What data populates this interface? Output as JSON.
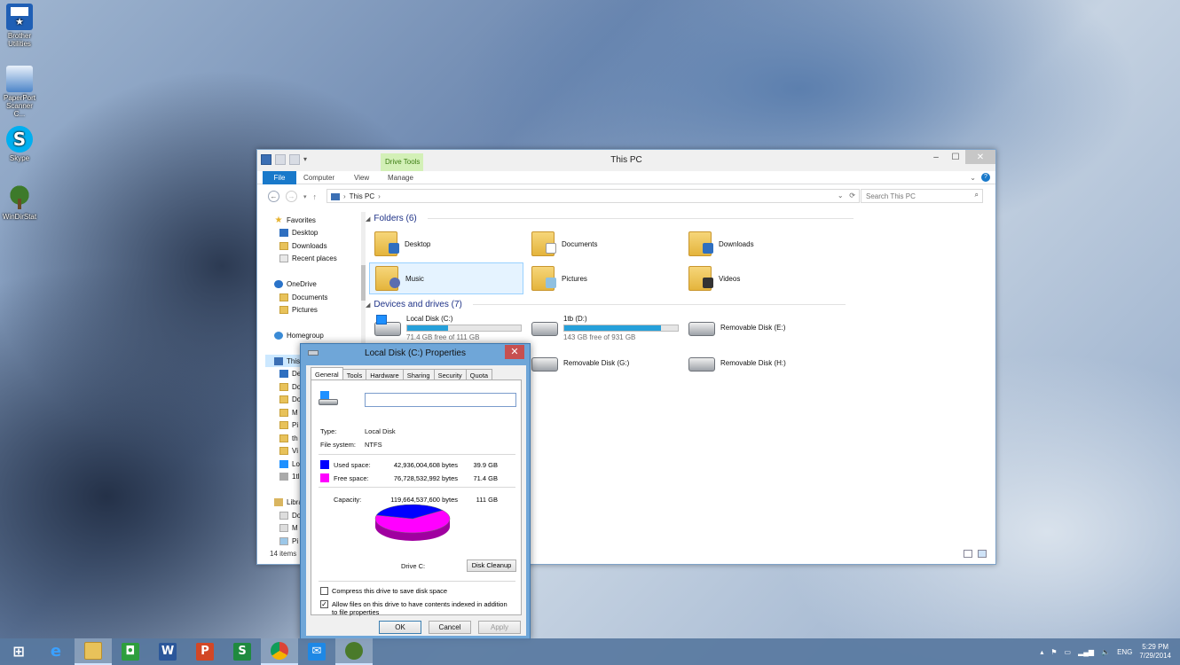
{
  "desktop": {
    "icons": [
      {
        "label": "Brother Utilities"
      },
      {
        "label": "PaperPort Scanner C..."
      },
      {
        "label": "Skype"
      },
      {
        "label": "WinDirStat"
      }
    ]
  },
  "explorer": {
    "title": "This PC",
    "context_tab": "Drive Tools",
    "tabs": [
      "File",
      "Computer",
      "View",
      "Manage"
    ],
    "address": "This PC",
    "search_placeholder": "Search This PC",
    "nav": {
      "favorites": "Favorites",
      "desktop": "Desktop",
      "downloads": "Downloads",
      "recent": "Recent places",
      "onedrive": "OneDrive",
      "documents": "Documents",
      "pictures": "Pictures",
      "homegroup": "Homegroup",
      "thispc": "This PC",
      "thispc_children": [
        "De",
        "Do",
        "Do",
        "M",
        "Pi",
        "th",
        "Vi",
        "Lo",
        "1tl"
      ],
      "libraries": "Libra",
      "lib_children": [
        "Do",
        "M",
        "Pi"
      ]
    },
    "folders_header": "Folders (6)",
    "folders": [
      {
        "name": "Desktop"
      },
      {
        "name": "Documents"
      },
      {
        "name": "Downloads"
      },
      {
        "name": "Music"
      },
      {
        "name": "Pictures"
      },
      {
        "name": "Videos"
      }
    ],
    "devices_header": "Devices and drives (7)",
    "drives": [
      {
        "name": "Local Disk (C:)",
        "free": "71.4 GB free of 111 GB",
        "used_fraction": 0.36
      },
      {
        "name": "1tb (D:)",
        "free": "143 GB free of 931 GB",
        "used_fraction": 0.85
      },
      {
        "name": "Removable Disk (E:)"
      },
      {
        "name": "Removable Disk (G:)"
      },
      {
        "name": "Removable Disk (H:)"
      }
    ],
    "status": "14 items"
  },
  "properties": {
    "title": "Local Disk (C:) Properties",
    "tabs": [
      "General",
      "Tools",
      "Hardware",
      "Sharing",
      "Security",
      "Quota"
    ],
    "type_label": "Type:",
    "type_value": "Local Disk",
    "fs_label": "File system:",
    "fs_value": "NTFS",
    "used_label": "Used space:",
    "used_bytes": "42,936,004,608 bytes",
    "used_gb": "39.9 GB",
    "free_label": "Free space:",
    "free_bytes": "76,728,532,992 bytes",
    "free_gb": "71.4 GB",
    "capacity_label": "Capacity:",
    "capacity_bytes": "119,664,537,600 bytes",
    "capacity_gb": "111 GB",
    "drive_label": "Drive C:",
    "cleanup_button": "Disk Cleanup",
    "compress_label": "Compress this drive to save disk space",
    "compress_checked": false,
    "index_label": "Allow files on this drive to have contents indexed in addition to file properties",
    "index_checked": true,
    "ok": "OK",
    "cancel": "Cancel",
    "apply": "Apply",
    "used_color": "#0000ff",
    "free_color": "#ff00ff",
    "used_fraction": 0.359
  },
  "taskbar": {
    "lang": "ENG",
    "time": "5:29 PM",
    "date": "7/29/2014"
  }
}
